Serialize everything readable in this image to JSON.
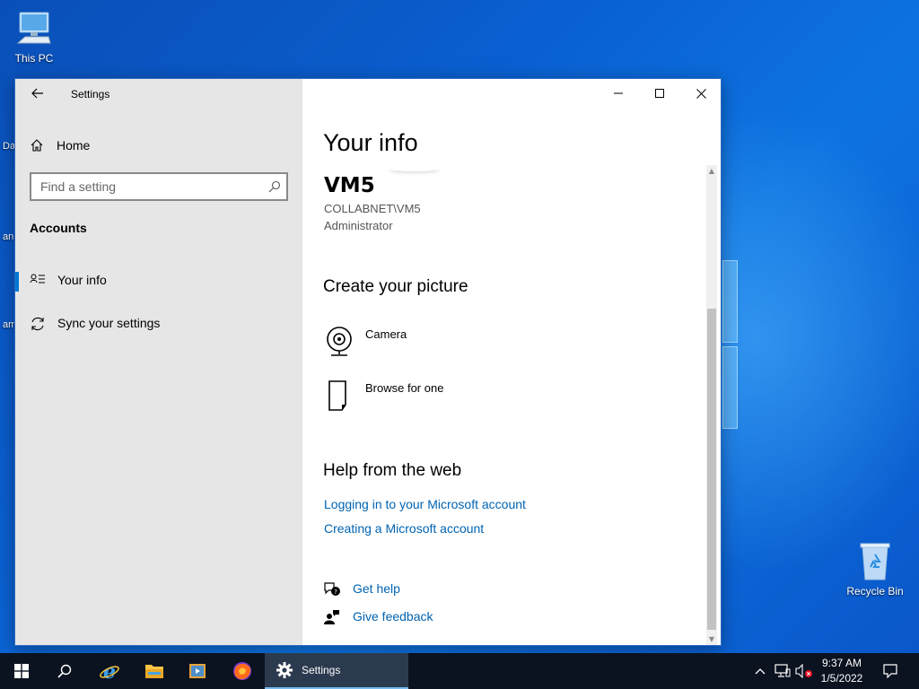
{
  "desktop": {
    "icons": {
      "this_pc": "This PC",
      "recycle_bin": "Recycle Bin"
    },
    "edge_fragments": [
      "Da",
      "an",
      "am"
    ]
  },
  "window": {
    "title": "Settings",
    "controls": {
      "minimize": "minimize-icon",
      "maximize": "maximize-icon",
      "close": "close-icon"
    }
  },
  "sidebar": {
    "home_label": "Home",
    "search": {
      "placeholder": "Find a setting",
      "value": ""
    },
    "section_label": "Accounts",
    "items": [
      {
        "label": "Your info",
        "icon": "contact-card-icon",
        "selected": true
      },
      {
        "label": "Sync your settings",
        "icon": "sync-icon",
        "selected": false
      }
    ]
  },
  "main": {
    "page_title": "Your info",
    "user": {
      "name": "VM5",
      "account": "COLLABNET\\VM5",
      "role": "Administrator"
    },
    "create_picture": {
      "heading": "Create your picture",
      "options": [
        {
          "label": "Camera",
          "icon": "camera-icon"
        },
        {
          "label": "Browse for one",
          "icon": "document-icon"
        }
      ]
    },
    "help_web": {
      "heading": "Help from the web",
      "links": [
        "Logging in to your Microsoft account",
        "Creating a Microsoft account"
      ]
    },
    "support": {
      "get_help": "Get help",
      "give_feedback": "Give feedback"
    }
  },
  "taskbar": {
    "active_app_label": "Settings",
    "clock": {
      "time": "9:37 AM",
      "date": "1/5/2022"
    }
  },
  "colors": {
    "accent": "#0078d4",
    "link": "#0063b1",
    "sidebar_bg": "#e6e6e6",
    "taskbar_bg": "#0b1220"
  }
}
